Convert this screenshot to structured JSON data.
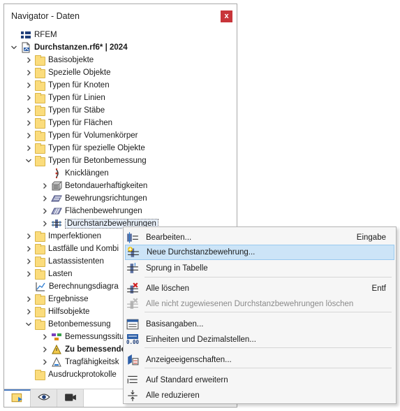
{
  "navigator": {
    "title": "Navigator - Daten",
    "close_glyph": "x",
    "tree": [
      {
        "label": "RFEM",
        "level": 0,
        "caret": "none",
        "icon": "flag-icon"
      },
      {
        "label": "Durchstanzen.rf6* | 2024",
        "level": 0,
        "caret": "open",
        "icon": "model-file-icon",
        "bold": true
      },
      {
        "label": "Basisobjekte",
        "level": 1,
        "caret": "closed",
        "icon": "folder-icon"
      },
      {
        "label": "Spezielle Objekte",
        "level": 1,
        "caret": "closed",
        "icon": "folder-icon"
      },
      {
        "label": "Typen für Knoten",
        "level": 1,
        "caret": "closed",
        "icon": "folder-icon"
      },
      {
        "label": "Typen für Linien",
        "level": 1,
        "caret": "closed",
        "icon": "folder-icon"
      },
      {
        "label": "Typen für Stäbe",
        "level": 1,
        "caret": "closed",
        "icon": "folder-icon"
      },
      {
        "label": "Typen für Flächen",
        "level": 1,
        "caret": "closed",
        "icon": "folder-icon"
      },
      {
        "label": "Typen für Volumenkörper",
        "level": 1,
        "caret": "closed",
        "icon": "folder-icon"
      },
      {
        "label": "Typen für spezielle Objekte",
        "level": 1,
        "caret": "closed",
        "icon": "folder-icon"
      },
      {
        "label": "Typen für Betonbemessung",
        "level": 1,
        "caret": "open",
        "icon": "folder-icon"
      },
      {
        "label": "Knicklängen",
        "level": 2,
        "caret": "none",
        "icon": "buckling-icon"
      },
      {
        "label": "Betondauerhaftigkeiten",
        "level": 2,
        "caret": "closed",
        "icon": "durability-icon"
      },
      {
        "label": "Bewehrungsrichtungen",
        "level": 2,
        "caret": "closed",
        "icon": "reinforcement-direction-icon"
      },
      {
        "label": "Flächenbewehrungen",
        "level": 2,
        "caret": "closed",
        "icon": "surface-reinforcement-icon"
      },
      {
        "label": "Durchstanzbewehrungen",
        "level": 2,
        "caret": "closed",
        "icon": "punching-reinforcement-icon",
        "selected": true
      },
      {
        "label": "Imperfektionen",
        "level": 1,
        "caret": "closed",
        "icon": "folder-icon"
      },
      {
        "label": "Lastfälle und Kombi",
        "level": 1,
        "caret": "closed",
        "icon": "folder-icon"
      },
      {
        "label": "Lastassistenten",
        "level": 1,
        "caret": "closed",
        "icon": "folder-icon"
      },
      {
        "label": "Lasten",
        "level": 1,
        "caret": "closed",
        "icon": "folder-icon"
      },
      {
        "label": "Berechnungsdiagra",
        "level": 1,
        "caret": "none",
        "icon": "diagram-icon"
      },
      {
        "label": "Ergebnisse",
        "level": 1,
        "caret": "closed",
        "icon": "folder-icon"
      },
      {
        "label": "Hilfsobjekte",
        "level": 1,
        "caret": "closed",
        "icon": "folder-icon"
      },
      {
        "label": "Betonbemessung",
        "level": 1,
        "caret": "open",
        "icon": "folder-icon"
      },
      {
        "label": "Bemessungssitu",
        "level": 2,
        "caret": "closed",
        "icon": "design-situation-icon"
      },
      {
        "label": "Zu bemessende",
        "level": 2,
        "caret": "closed",
        "icon": "objects-to-design-icon",
        "bold": true
      },
      {
        "label": "Tragfähigkeitsk",
        "level": 2,
        "caret": "closed",
        "icon": "ultimate-limit-icon"
      },
      {
        "label": "Ausdruckprotokolle",
        "level": 1,
        "caret": "none",
        "icon": "folder-icon"
      }
    ],
    "bottom_tabs": [
      {
        "name": "data-tab",
        "icon": "data-navigator-icon",
        "active": true
      },
      {
        "name": "display-tab",
        "icon": "eye-icon",
        "active": false
      },
      {
        "name": "views-tab",
        "icon": "camera-icon",
        "active": false
      }
    ]
  },
  "context_menu": {
    "items": [
      {
        "label": "Bearbeiten...",
        "shortcut": "Eingabe",
        "icon": "edit-icon",
        "enabled": true
      },
      {
        "label": "Neue Durchstanzbewehrung...",
        "shortcut": "",
        "icon": "new-punching-icon",
        "enabled": true,
        "highlighted": true
      },
      {
        "label": "Sprung in Tabelle",
        "shortcut": "",
        "icon": "jump-to-table-icon",
        "enabled": true
      },
      {
        "label": "Alle löschen",
        "shortcut": "Entf",
        "icon": "delete-all-icon",
        "enabled": true
      },
      {
        "label": "Alle nicht zugewiesenen Durchstanzbewehrungen löschen",
        "shortcut": "",
        "icon": "delete-unassigned-icon",
        "enabled": false
      },
      {
        "label": "Basisangaben...",
        "shortcut": "",
        "icon": "base-data-icon",
        "enabled": true
      },
      {
        "label": "Einheiten und Dezimalstellen...",
        "shortcut": "",
        "icon": "units-icon",
        "enabled": true
      },
      {
        "label": "Anzeigeeigenschaften...",
        "shortcut": "",
        "icon": "display-properties-icon",
        "enabled": true
      },
      {
        "label": "Auf Standard erweitern",
        "shortcut": "",
        "icon": "expand-icon",
        "enabled": true
      },
      {
        "label": "Alle reduzieren",
        "shortcut": "",
        "icon": "collapse-icon",
        "enabled": true
      }
    ],
    "units_icon_text": "0.00"
  },
  "colors": {
    "folder": "#fbdc7c",
    "close_button": "#c8353a",
    "menu_highlight": "#cce4f7",
    "active_tab_accent": "#4a7bc0"
  }
}
